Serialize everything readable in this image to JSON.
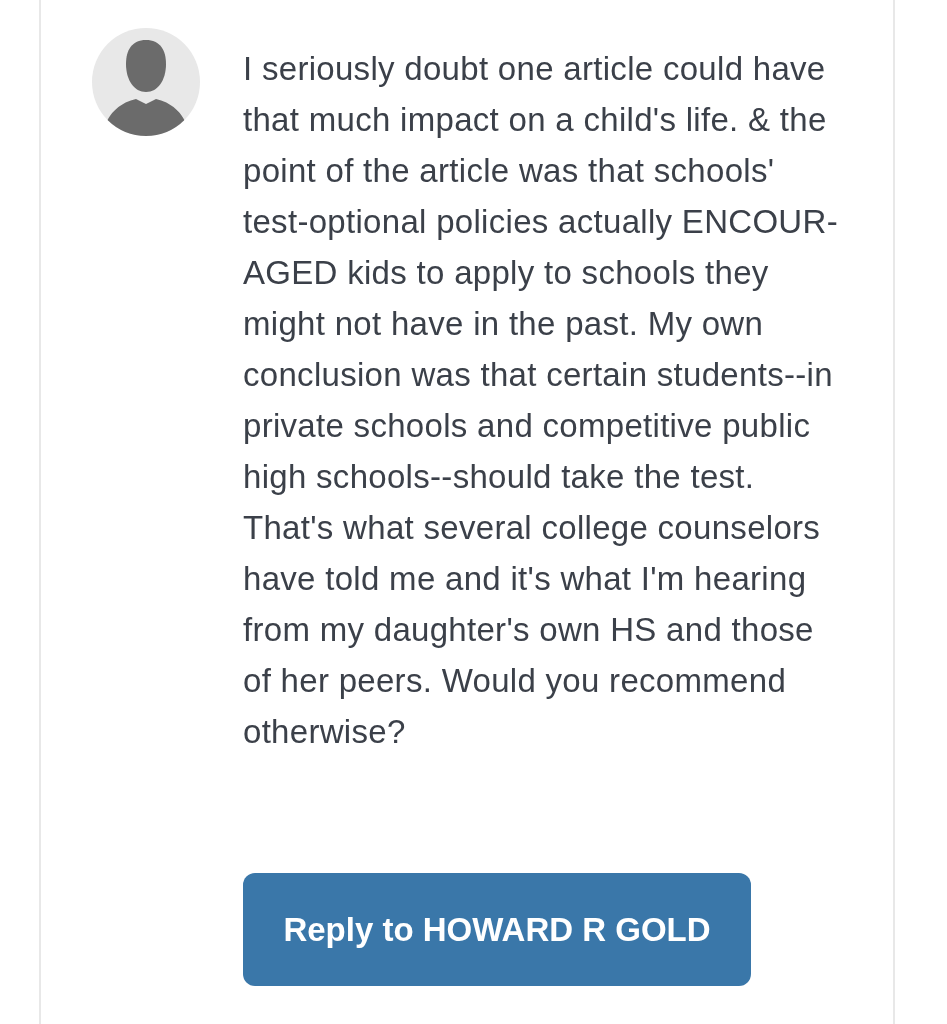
{
  "comment": {
    "text": "I seriously doubt one article could have that much impact on a child's life. & the point of the article was that schools' test-optional policies actually ENCOUR-AGED kids to apply to schools they might not have in the past. My own conclusion was that certain students--in private schools and competitive public high schools--should take the test. That's what several college counselors have told me and it's what I'm hearing from my daughter's own HS and those of her peers. Would you recommend otherwise?",
    "reply_button": {
      "label": "Reply to HOWARD R GOLD"
    }
  }
}
